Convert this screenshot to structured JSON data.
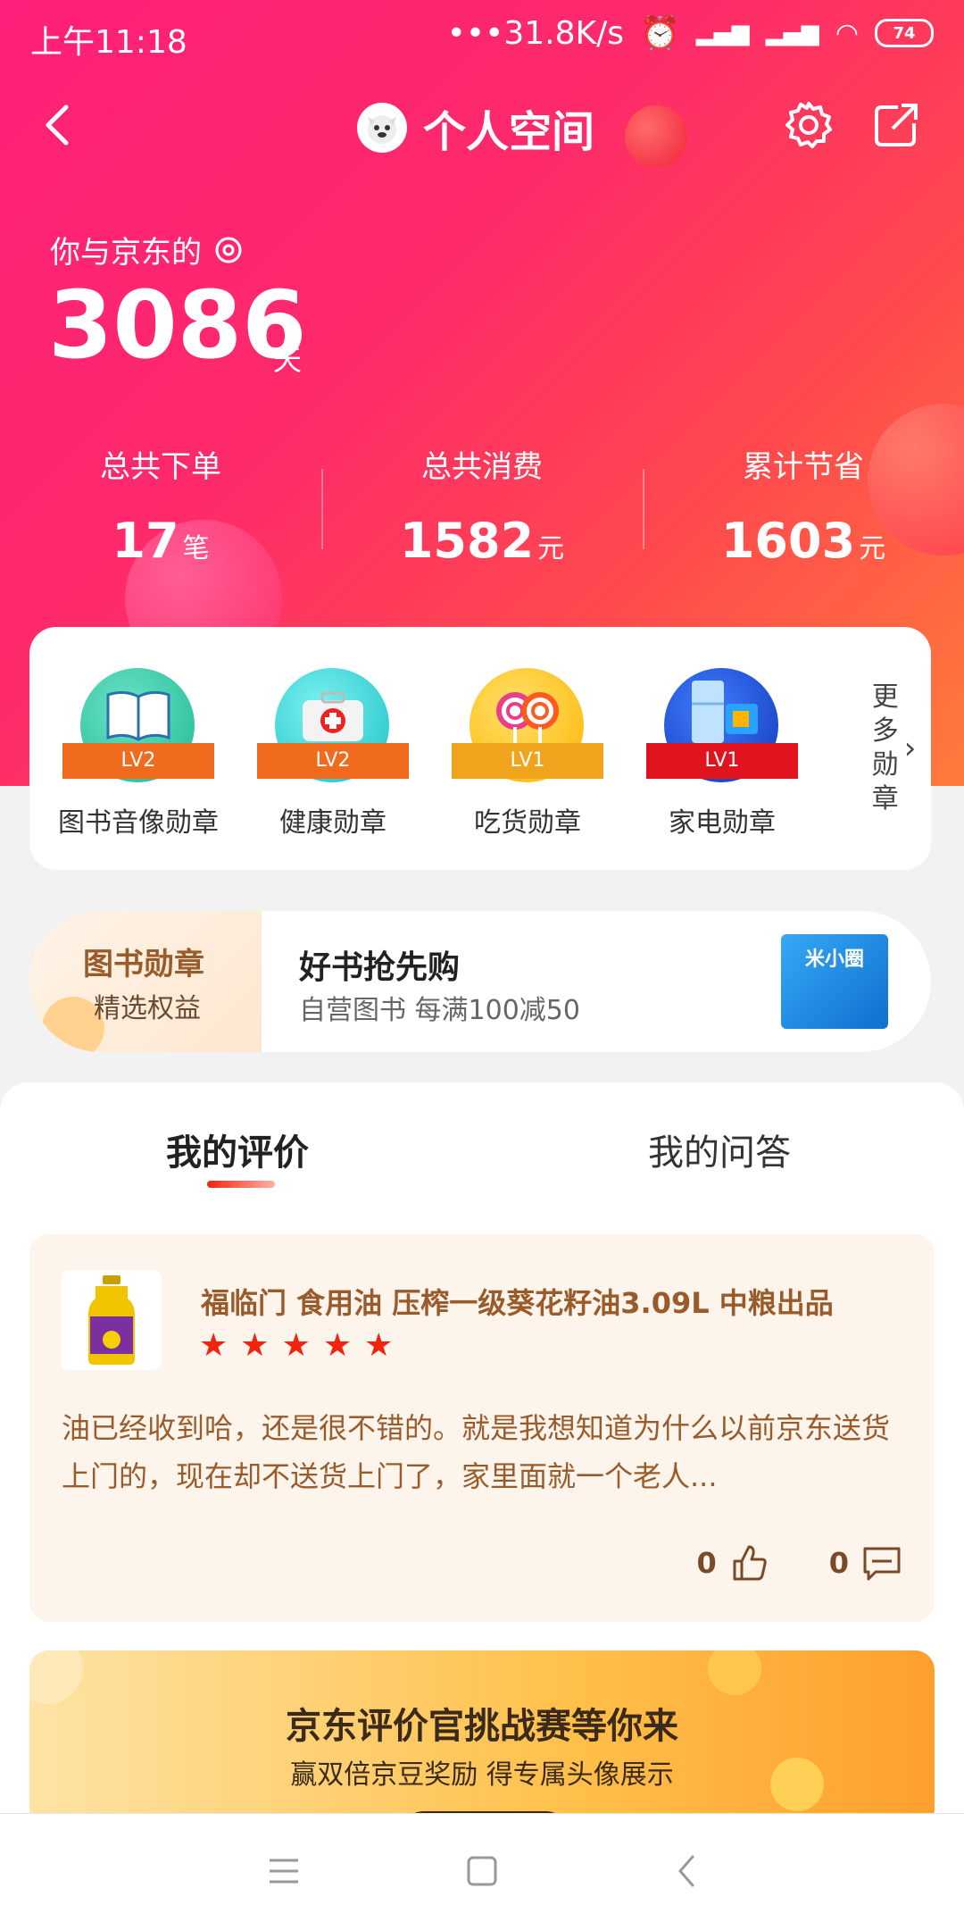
{
  "status_bar": {
    "time": "上午11:18",
    "speed": "•••31.8K/s",
    "battery": "74"
  },
  "header": {
    "title": "个人空间"
  },
  "days": {
    "label": "你与京东的",
    "count": "3086",
    "unit": "天"
  },
  "stats": [
    {
      "label": "总共下单",
      "value": "17",
      "unit": "笔"
    },
    {
      "label": "总共消费",
      "value": "1582",
      "unit": "元"
    },
    {
      "label": "累计节省",
      "value": "1603",
      "unit": "元"
    }
  ],
  "medals": [
    {
      "name": "图书音像勋章",
      "level": "LV2",
      "icon": "book-icon",
      "color": "#29c7a4",
      "ribbon": "#f06b1d"
    },
    {
      "name": "健康勋章",
      "level": "LV2",
      "icon": "first-aid-kit-icon",
      "color": "#2fd3d6",
      "ribbon": "#f06b1d"
    },
    {
      "name": "吃货勋章",
      "level": "LV1",
      "icon": "lollipop-icon",
      "color": "#ffc21e",
      "ribbon": "#f0a31d"
    },
    {
      "name": "家电勋章",
      "level": "LV1",
      "icon": "appliance-icon",
      "color": "#1d56d8",
      "ribbon": "#e0131e"
    }
  ],
  "more_medals": "更多勋章",
  "banner": {
    "tag_title": "图书勋章",
    "tag_sub": "精选权益",
    "title": "好书抢先购",
    "subtitle": "自营图书   每满100减50",
    "book_cover_text": "米小圈"
  },
  "tabs": [
    {
      "label": "我的评价",
      "active": true
    },
    {
      "label": "我的问答",
      "active": false
    }
  ],
  "review": {
    "product_name": "福临门 食用油 压榨一级葵花籽油3.09L 中粮出品",
    "stars": 5,
    "text": "油已经收到哈，还是很不错的。就是我想知道为什么以前京东送货上门的，现在却不送货上门了，家里面就一个老人...",
    "likes": "0",
    "comments": "0"
  },
  "promo": {
    "title": "京东评价官挑战赛等你来",
    "subtitle": "赢双倍京豆奖励 得专属头像展示"
  },
  "colors": {
    "accent": "#f0250f",
    "hero_start": "#ff1f7a",
    "hero_end": "#ff7b3a"
  }
}
